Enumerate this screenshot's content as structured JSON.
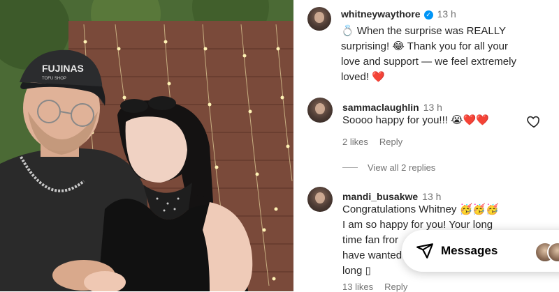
{
  "post": {
    "author": "whitneywaythore",
    "time": "13 h",
    "caption_line1": "💍 When the surprise was REALLY",
    "caption_line2": "surprising! 😂 Thank you for all your",
    "caption_line3": "love and support — we feel extremely",
    "caption_line4": "loved! ❤️"
  },
  "photo": {
    "cap_text_1": "FUJINAS",
    "cap_text_2": "TOFU SHOP"
  },
  "comments": [
    {
      "username": "sammaclaughlin",
      "time": "13 h",
      "text": "Soooo happy for you!!! 😭❤️❤️",
      "likes": "2 likes",
      "reply": "Reply",
      "view_replies": "View all 2 replies"
    },
    {
      "username": "mandi_busakwe",
      "time": "13 h",
      "line1": "Congratulations Whitney 🥳🥳🥳",
      "line2": "I am so happy for you! Your long",
      "line3": "time fan fror",
      "line4": "have wanted",
      "line5": "long ▯",
      "likes": "13 likes",
      "reply": "Reply"
    }
  ],
  "messages": {
    "label": "Messages"
  },
  "colors": {
    "verified": "#0095f6",
    "heart": "#ed4956",
    "muted": "#737373"
  }
}
